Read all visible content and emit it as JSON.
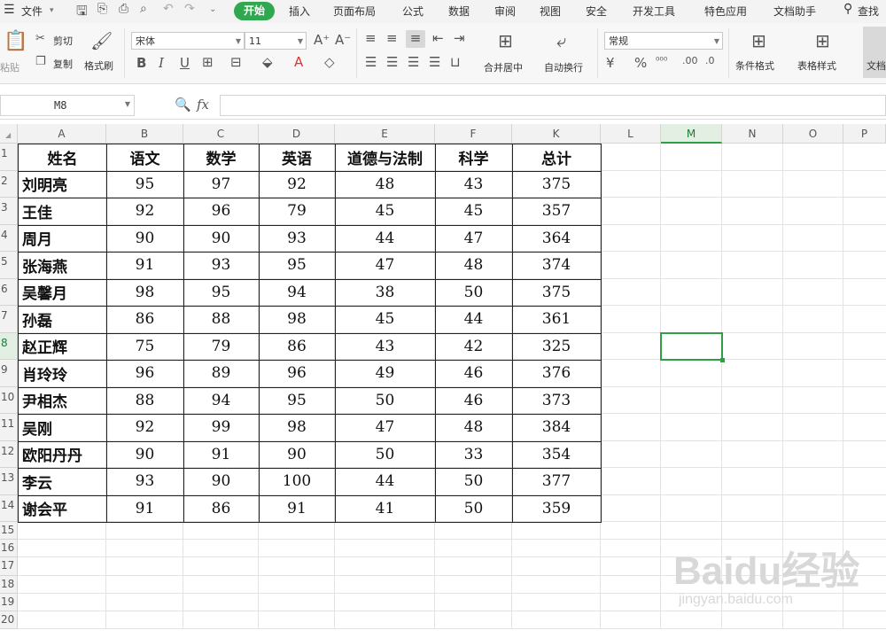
{
  "menu": {
    "file": "文件",
    "items": [
      "开始",
      "插入",
      "页面布局",
      "公式",
      "数据",
      "审阅",
      "视图",
      "安全",
      "开发工具",
      "特色应用",
      "文档助手"
    ],
    "search": "查找"
  },
  "ribbon": {
    "paste": "粘贴",
    "cut": "剪切",
    "copy": "复制",
    "format_painter": "格式刷",
    "font_name": "宋体",
    "font_size": "11",
    "merge_center": "合并居中",
    "wrap_text": "自动换行",
    "number_format": "常规",
    "conditional_format": "条件格式",
    "table_style": "表格样式",
    "document": "文档"
  },
  "formula_bar": {
    "name_box": "M8",
    "fx": "fx",
    "content": ""
  },
  "columns": [
    "A",
    "B",
    "C",
    "D",
    "E",
    "F",
    "K",
    "L",
    "M",
    "N",
    "O",
    "P"
  ],
  "selected_column": "M",
  "selected_row": "8",
  "table": {
    "headers": [
      "姓名",
      "语文",
      "数学",
      "英语",
      "道德与法制",
      "科学",
      "总计"
    ],
    "rows": [
      [
        "刘明亮",
        "95",
        "97",
        "92",
        "48",
        "43",
        "375"
      ],
      [
        "王佳",
        "92",
        "96",
        "79",
        "45",
        "45",
        "357"
      ],
      [
        "周月",
        "90",
        "90",
        "93",
        "44",
        "47",
        "364"
      ],
      [
        "张海燕",
        "91",
        "93",
        "95",
        "47",
        "48",
        "374"
      ],
      [
        "吴馨月",
        "98",
        "95",
        "94",
        "38",
        "50",
        "375"
      ],
      [
        "孙磊",
        "86",
        "88",
        "98",
        "45",
        "44",
        "361"
      ],
      [
        "赵正辉",
        "75",
        "79",
        "86",
        "43",
        "42",
        "325"
      ],
      [
        "肖玲玲",
        "96",
        "89",
        "96",
        "49",
        "46",
        "376"
      ],
      [
        "尹相杰",
        "88",
        "94",
        "95",
        "50",
        "46",
        "373"
      ],
      [
        "吴刚",
        "92",
        "99",
        "98",
        "47",
        "48",
        "384"
      ],
      [
        "欧阳丹丹",
        "90",
        "91",
        "90",
        "50",
        "33",
        "354"
      ],
      [
        "李云",
        "93",
        "90",
        "100",
        "44",
        "50",
        "377"
      ],
      [
        "谢会平",
        "91",
        "86",
        "91",
        "41",
        "50",
        "359"
      ]
    ]
  },
  "row_numbers": [
    "1",
    "2",
    "3",
    "4",
    "5",
    "6",
    "7",
    "8",
    "9",
    "10",
    "11",
    "12",
    "13",
    "14",
    "15",
    "16",
    "17",
    "18",
    "19",
    "20"
  ],
  "watermark": {
    "brand": "Baidu经验",
    "url": "jingyan.baidu.com"
  },
  "colors": {
    "accent": "#2fa84f",
    "selection": "#2f9e44"
  }
}
